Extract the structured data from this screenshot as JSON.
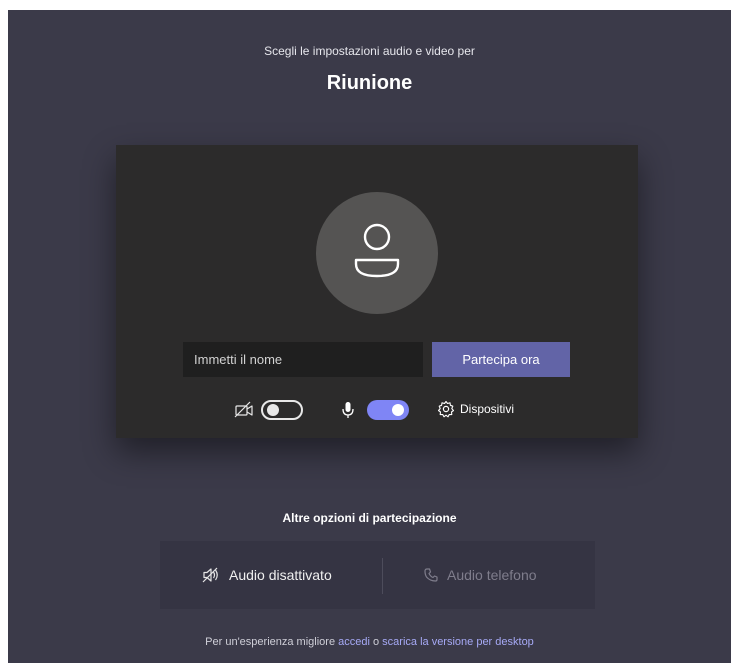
{
  "header": {
    "subtitle": "Scegli le impostazioni audio e video per",
    "title": "Riunione"
  },
  "prejoin": {
    "name_placeholder": "Immetti il nome",
    "name_value": "",
    "join_label": "Partecipa ora",
    "camera_toggle_on": false,
    "mic_toggle_on": true,
    "devices_label": "Dispositivi"
  },
  "other_options": {
    "title": "Altre opzioni di partecipazione",
    "audio_off_label": "Audio disattivato",
    "phone_audio_label": "Audio telefono"
  },
  "footer": {
    "text_before": "Per un'esperienza migliore",
    "link_signin": "accedi",
    "text_middle": "o",
    "link_download": "scarica la versione per desktop"
  },
  "colors": {
    "background": "#3b3a49",
    "preview": "#2c2b2b",
    "accent": "#6264a7",
    "toggle_on": "#7f85f5"
  }
}
